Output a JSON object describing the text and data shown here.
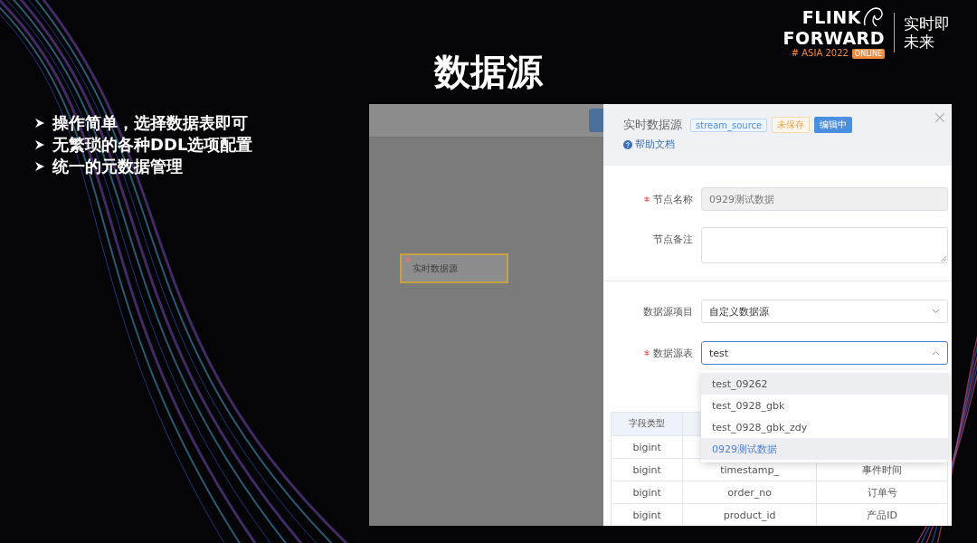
{
  "slide": {
    "title": "数据源",
    "bullets": [
      "操作简单，选择数据表即可",
      "无繁琐的各种DDL选项配置",
      "统一的元数据管理"
    ],
    "logo": {
      "line_1": "FLINK",
      "line_2": "FORWARD",
      "edition": "# ASIA 2022",
      "badge": "ONLINE",
      "slogan": [
        "实时即",
        "未来"
      ]
    }
  },
  "screenshot": {
    "canvas": {
      "node": {
        "label": "实时数据源",
        "required": true
      }
    },
    "drawer": {
      "title": "实时数据源",
      "tags": [
        {
          "label": "stream_source",
          "kind": "info"
        },
        {
          "label": "未保存",
          "kind": "warning"
        },
        {
          "label": "编辑中",
          "kind": "primary"
        }
      ],
      "help_link": "帮助文档",
      "form": [
        {
          "kind": "input",
          "label": "节点名称",
          "required": true,
          "disabled": true,
          "value": "0929测试数据"
        },
        {
          "kind": "textarea",
          "label": "节点备注",
          "required": false,
          "disabled": false
        },
        {
          "kind": "select",
          "label": "数据源项目",
          "required": false,
          "disabled": false,
          "value": "自定义数据源",
          "expanded": false
        },
        {
          "kind": "select",
          "label": "数据源表",
          "required": true,
          "disabled": false,
          "value": "test",
          "expanded": true
        }
      ],
      "dropdown": [
        {
          "label": "test_09262",
          "hovered": true,
          "selected": false
        },
        {
          "label": "test_0928_gbk",
          "hovered": false,
          "selected": false
        },
        {
          "label": "test_0928_gbk_zdy",
          "hovered": false,
          "selected": false
        },
        {
          "label": "0929测试数据",
          "hovered": true,
          "selected": true
        }
      ],
      "table": {
        "columns": [
          "字段类型"
        ],
        "rows": [
          {
            "cells": [
              "bigint"
            ]
          },
          {
            "cells": [
              "bigint",
              "timestamp_",
              "事件时间"
            ]
          },
          {
            "cells": [
              "bigint",
              "order_no",
              "订单号"
            ]
          },
          {
            "cells": [
              "bigint",
              "product_id",
              "产品ID"
            ]
          }
        ]
      }
    }
  }
}
